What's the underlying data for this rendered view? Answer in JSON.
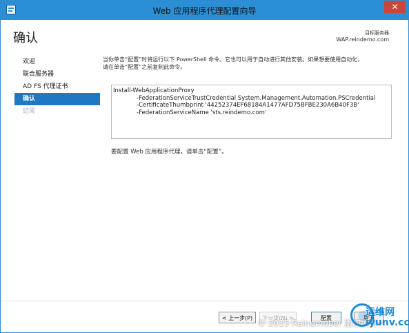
{
  "window": {
    "title": "Web 应用程序代理配置向导",
    "close_label": "✕"
  },
  "header": {
    "page_title": "确认",
    "target_label": "目标服务器",
    "target_value": "WAP.reindemo.com"
  },
  "nav": {
    "items": [
      {
        "label": "欢迎",
        "state": "normal"
      },
      {
        "label": "联合服务器",
        "state": "normal"
      },
      {
        "label": "AD FS 代理证书",
        "state": "normal"
      },
      {
        "label": "确认",
        "state": "active"
      },
      {
        "label": "结果",
        "state": "disabled"
      }
    ]
  },
  "content": {
    "intro_line1": "当你单击“配置”时将运行以下 PowerShell 命令。它也可以用于自动进行其他安装。如果想要使用自动化，",
    "intro_line2": "请在单击“配置”之前复制此命令。",
    "code_lines": [
      "Install-WebApplicationProxy",
      "-FederationServiceTrustCredential System.Management.Automation.PSCredential",
      "-CertificateThumbprint '44252374EF68184A1477AFD75BFBE230A6B40F3B'",
      "-FederationServiceName 'sts.reindemo.com'"
    ],
    "prompt": "要配置 Web 应用程序代理，请单击“配置”。"
  },
  "footer": {
    "prev_label": "< 上一步(P)",
    "next_label": "下一步(N) >",
    "configure_label": "配置",
    "cancel_label": "取消"
  },
  "watermark": {
    "text": "© 2015 Reinemeber 版权所有"
  },
  "logo": {
    "line1": "运维网",
    "line2": "iyunv.com"
  },
  "colors": {
    "titlebar": "#2b8fd6",
    "nav_active": "#1f78c2",
    "logo": "#1b89d5"
  }
}
